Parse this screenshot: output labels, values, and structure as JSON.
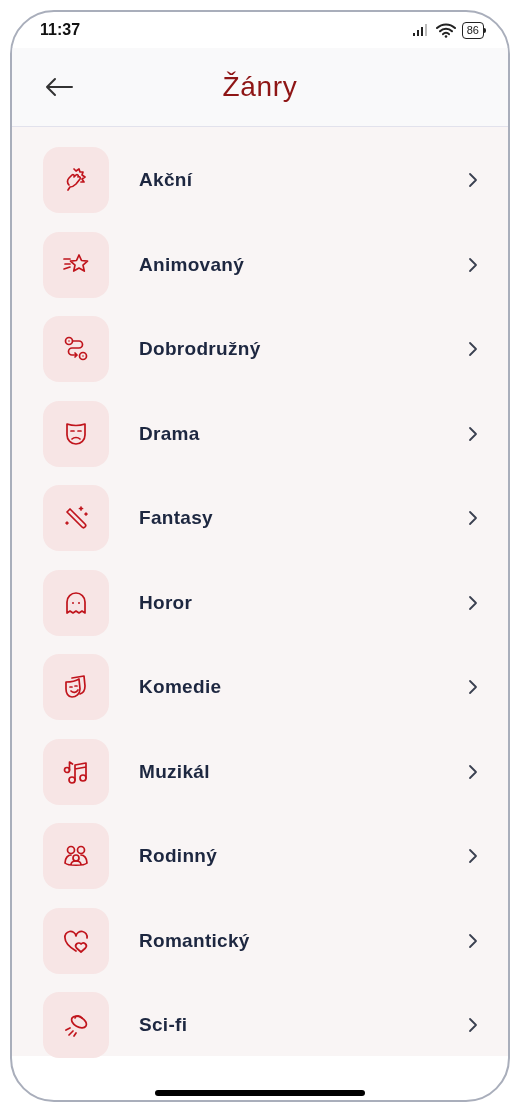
{
  "status_bar": {
    "time": "11:37",
    "battery": "86"
  },
  "header": {
    "title": "Žánry"
  },
  "genres": [
    {
      "label": "Akční"
    },
    {
      "label": "Animovaný"
    },
    {
      "label": "Dobrodružný"
    },
    {
      "label": "Drama"
    },
    {
      "label": "Fantasy"
    },
    {
      "label": "Horor"
    },
    {
      "label": "Komedie"
    },
    {
      "label": "Muzikál"
    },
    {
      "label": "Rodinný"
    },
    {
      "label": "Romantický"
    },
    {
      "label": "Sci-fi"
    }
  ]
}
